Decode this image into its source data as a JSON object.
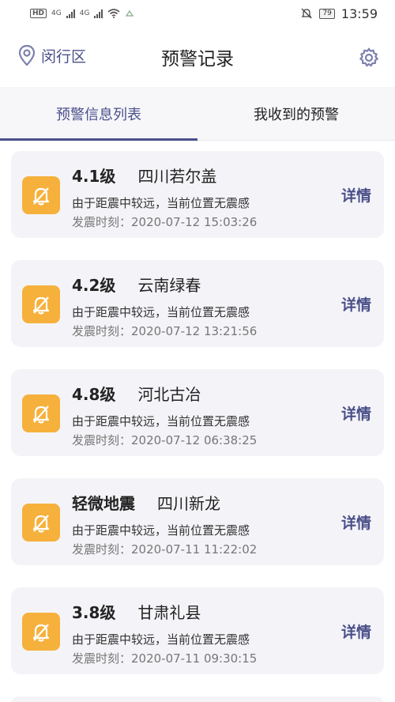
{
  "status_bar": {
    "hd": "HD",
    "net1": "4G",
    "net2": "4G",
    "battery": "79",
    "time": "13:59"
  },
  "header": {
    "location": "闵行区",
    "title": "预警记录"
  },
  "tabs": [
    {
      "label": "预警信息列表",
      "active": true
    },
    {
      "label": "我收到的预警",
      "active": false
    }
  ],
  "records": [
    {
      "magnitude": "4.1级",
      "place": "四川若尔盖",
      "desc": "由于距震中较远，当前位置无震感",
      "time": "发震时刻：2020-07-12 15:03:26",
      "action": "详情"
    },
    {
      "magnitude": "4.2级",
      "place": "云南绿春",
      "desc": "由于距震中较远，当前位置无震感",
      "time": "发震时刻：2020-07-12 13:21:56",
      "action": "详情"
    },
    {
      "magnitude": "4.8级",
      "place": "河北古冶",
      "desc": "由于距震中较远，当前位置无震感",
      "time": "发震时刻：2020-07-12 06:38:25",
      "action": "详情"
    },
    {
      "magnitude": "轻微地震",
      "place": "四川新龙",
      "desc": "由于距震中较远，当前位置无震感",
      "time": "发震时刻：2020-07-11 11:22:02",
      "action": "详情"
    },
    {
      "magnitude": "3.8级",
      "place": "甘肃礼县",
      "desc": "由于距震中较远，当前位置无震感",
      "time": "发震时刻：2020-07-11 09:30:15",
      "action": "详情"
    }
  ],
  "icons": {
    "location": "location-pin-icon",
    "settings": "gear-icon",
    "alert": "bell-muted-icon"
  },
  "colors": {
    "accent": "#4a4f8a",
    "alert_icon_bg": "#f6b13c",
    "card_bg": "#f4f4f8"
  }
}
